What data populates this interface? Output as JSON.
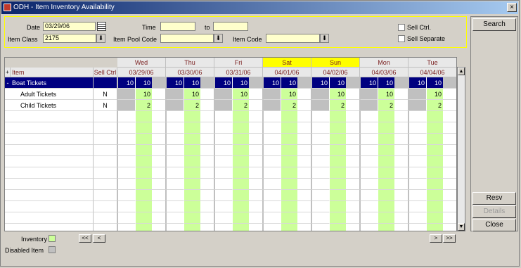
{
  "window": {
    "title": "ODH - Item Inventory Availability",
    "close_glyph": "×"
  },
  "filters": {
    "date_label": "Date",
    "date_value": "03/29/06",
    "time_label": "Time",
    "time_from": "",
    "to_label": "to",
    "time_to": "",
    "item_class_label": "Item Class",
    "item_class_value": "2175",
    "item_pool_code_label": "Item Pool Code",
    "item_pool_code_value": "",
    "item_code_label": "Item Code",
    "item_code_value": "",
    "sell_ctrl_label": "Sell Ctrl.",
    "sell_separate_label": "Sell Separate",
    "dropdown_glyph": "⬇"
  },
  "buttons": {
    "search": "Search",
    "resv": "Resv",
    "details": "Details",
    "close": "Close"
  },
  "grid": {
    "expand_marker": "+",
    "item_header": "Item",
    "sell_ctrl_header": "Sell Ctrl",
    "days": [
      {
        "day": "Wed",
        "date": "03/29/06",
        "weekend": false
      },
      {
        "day": "Thu",
        "date": "03/30/06",
        "weekend": false
      },
      {
        "day": "Fri",
        "date": "03/31/06",
        "weekend": false
      },
      {
        "day": "Sat",
        "date": "04/01/06",
        "weekend": true
      },
      {
        "day": "Sun",
        "date": "04/02/06",
        "weekend": true
      },
      {
        "day": "Mon",
        "date": "04/03/06",
        "weekend": false
      },
      {
        "day": "Tue",
        "date": "04/04/06",
        "weekend": false
      }
    ],
    "rows": [
      {
        "marker": "-",
        "name": "Boat Tickets",
        "sell_ctrl": "",
        "left": "10",
        "right": "10",
        "selected": true
      },
      {
        "marker": "",
        "name": "Adult Tickets",
        "sell_ctrl": "N",
        "left": "",
        "right": "10",
        "selected": false
      },
      {
        "marker": "",
        "name": "Child Tickets",
        "sell_ctrl": "N",
        "left": "",
        "right": "2",
        "selected": false
      }
    ],
    "empty_row_count": 12
  },
  "legend": {
    "inventory_label": "Inventory",
    "disabled_label": "Disabled Item",
    "inventory_color": "#ccff99",
    "disabled_color": "#c0c0c0"
  },
  "nav": {
    "first": "<<",
    "prev": "<",
    "next": ">",
    "last": ">>"
  },
  "colors": {
    "selected_row": "#000080",
    "weekend_header": "#ffff00",
    "day_header_text": "#7a1f1f"
  }
}
